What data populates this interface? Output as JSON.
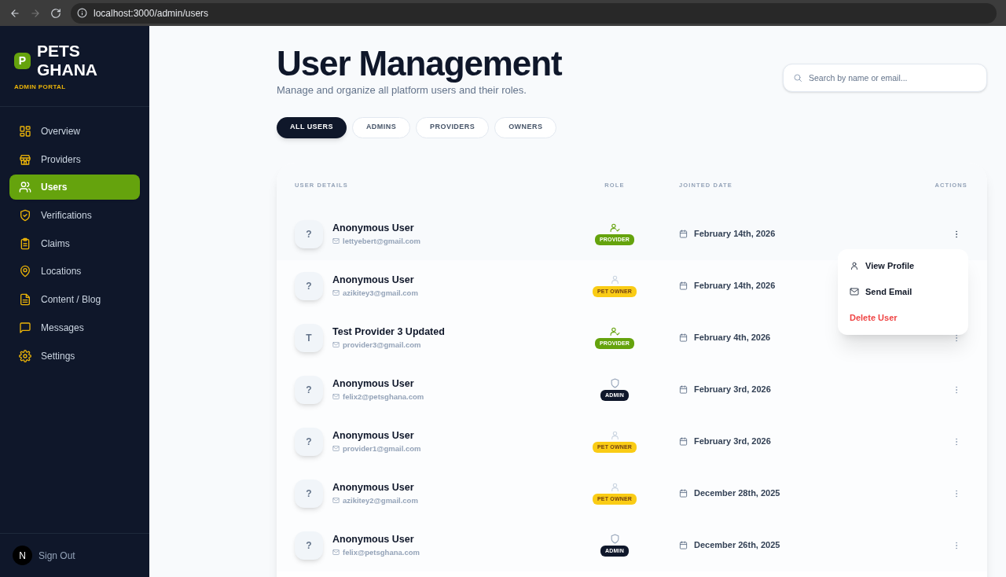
{
  "browser": {
    "url": "localhost:3000/admin/users"
  },
  "sidebar": {
    "brand_line_1": "PETS",
    "brand_line_2": "GHANA",
    "logo_letter": "P",
    "subtitle": "ADMIN PORTAL",
    "items": [
      {
        "label": "Overview",
        "kind": "grid",
        "selected": false
      },
      {
        "label": "Providers",
        "kind": "store",
        "selected": false
      },
      {
        "label": "Users",
        "kind": "users",
        "selected": true
      },
      {
        "label": "Verifications",
        "kind": "shield",
        "selected": false
      },
      {
        "label": "Claims",
        "kind": "clipboard",
        "selected": false
      },
      {
        "label": "Locations",
        "kind": "pin",
        "selected": false
      },
      {
        "label": "Content / Blog",
        "kind": "file",
        "selected": false
      },
      {
        "label": "Messages",
        "kind": "message",
        "selected": false
      },
      {
        "label": "Settings",
        "kind": "gear",
        "selected": false
      }
    ],
    "dev_badge": "N",
    "sign_out": "Sign Out"
  },
  "header": {
    "title": "User Management",
    "subtitle": "Manage and organize all platform users and their roles.",
    "search_placeholder": "Search by name or email..."
  },
  "tabs": [
    {
      "label": "ALL USERS",
      "selected": true
    },
    {
      "label": "ADMINS",
      "selected": false
    },
    {
      "label": "PROVIDERS",
      "selected": false
    },
    {
      "label": "OWNERS",
      "selected": false
    }
  ],
  "table": {
    "columns": [
      "USER DETAILS",
      "ROLE",
      "JOINTED DATE",
      "ACTIONS"
    ],
    "rows": [
      {
        "initial": "?",
        "name": "Anonymous User",
        "email": "lettyebert@gmail.com",
        "role": "PROVIDER",
        "kind": "provider",
        "date": "February 14th, 2026",
        "menu_open": true
      },
      {
        "initial": "?",
        "name": "Anonymous User",
        "email": "azikitey3@gmail.com",
        "role": "PET OWNER",
        "kind": "owner",
        "date": "February 14th, 2026",
        "menu_open": false
      },
      {
        "initial": "T",
        "name": "Test Provider 3 Updated",
        "email": "provider3@gmail.com",
        "role": "PROVIDER",
        "kind": "provider",
        "date": "February 4th, 2026",
        "menu_open": false
      },
      {
        "initial": "?",
        "name": "Anonymous User",
        "email": "felix2@petsghana.com",
        "role": "ADMIN",
        "kind": "admin",
        "date": "February 3rd, 2026",
        "menu_open": false
      },
      {
        "initial": "?",
        "name": "Anonymous User",
        "email": "provider1@gmail.com",
        "role": "PET OWNER",
        "kind": "owner",
        "date": "February 3rd, 2026",
        "menu_open": false
      },
      {
        "initial": "?",
        "name": "Anonymous User",
        "email": "azikitey2@gmail.com",
        "role": "PET OWNER",
        "kind": "owner",
        "date": "December 28th, 2025",
        "menu_open": false
      },
      {
        "initial": "?",
        "name": "Anonymous User",
        "email": "felix@petsghana.com",
        "role": "ADMIN",
        "kind": "admin",
        "date": "December 26th, 2025",
        "menu_open": false
      }
    ],
    "menu": [
      {
        "label": "View Profile",
        "kind": "profile"
      },
      {
        "label": "Send Email",
        "kind": "email"
      },
      {
        "label": "Delete User",
        "kind": "danger"
      }
    ]
  }
}
